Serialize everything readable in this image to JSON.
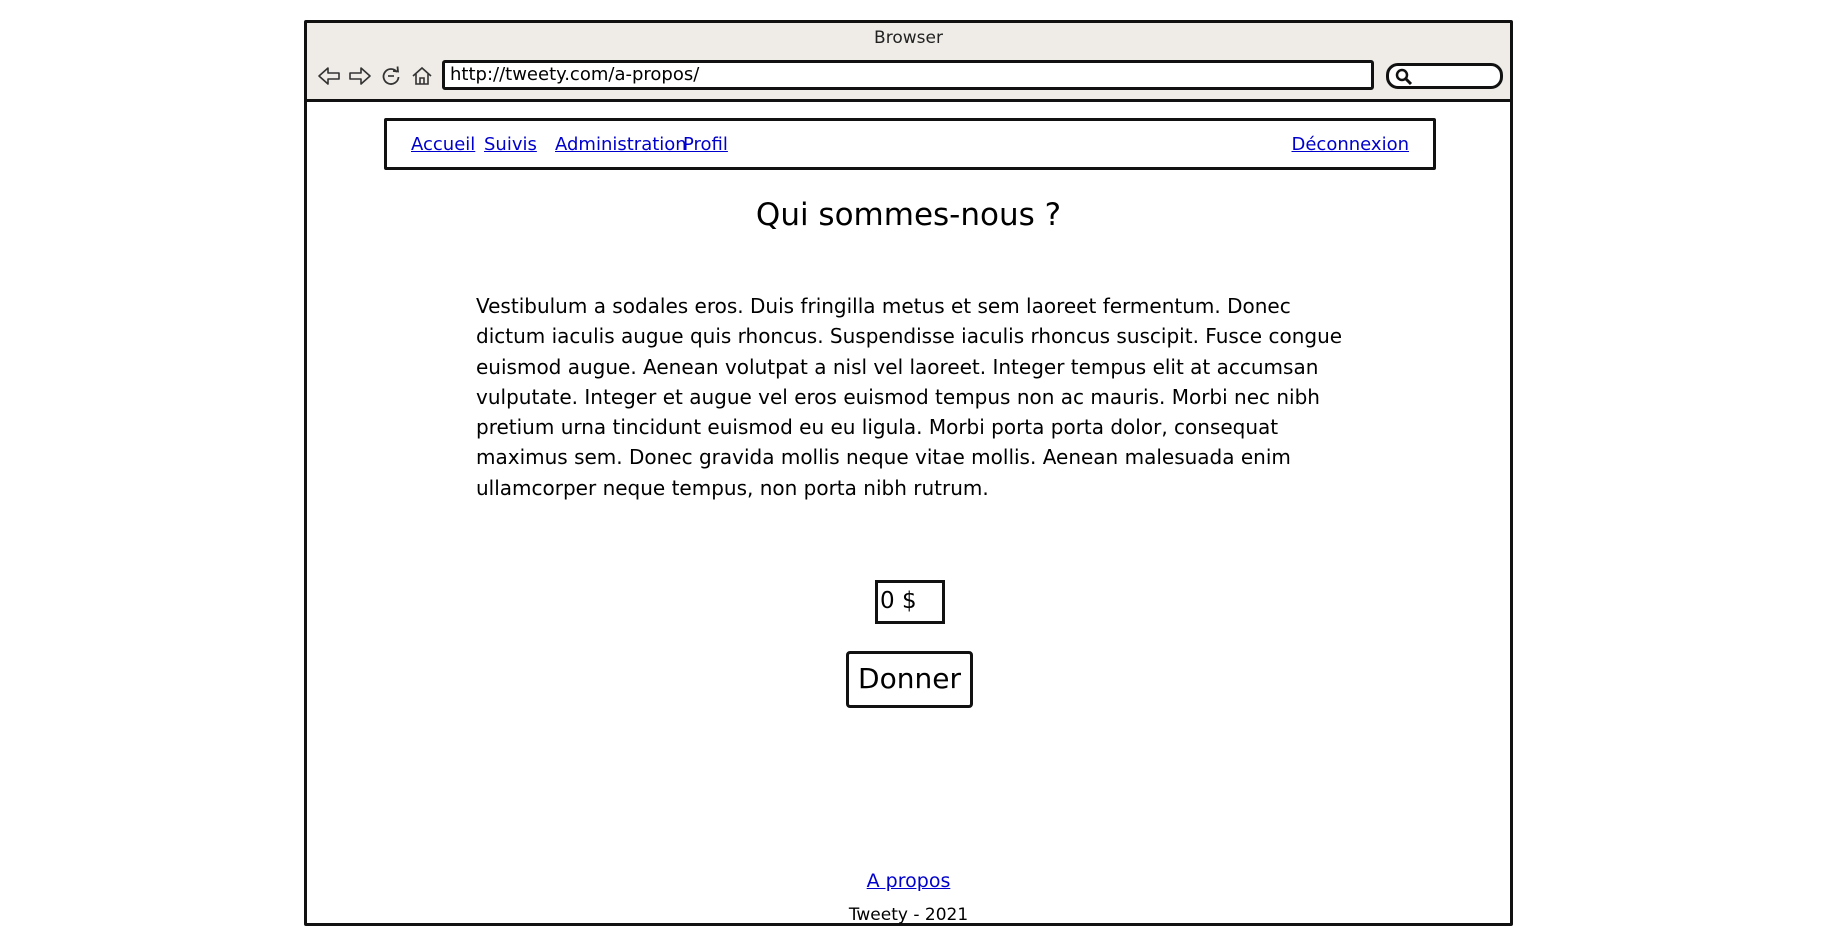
{
  "window": {
    "title": "Browser"
  },
  "toolbar": {
    "icons": [
      "back-arrow-icon",
      "forward-arrow-icon",
      "reload-icon",
      "home-icon"
    ],
    "url": "http://tweety.com/a-propos/",
    "search_icon": "search-icon"
  },
  "nav": {
    "items": [
      {
        "label": "Accueil"
      },
      {
        "label": "Suivis"
      },
      {
        "label": "Administration"
      },
      {
        "label": "Profil"
      }
    ],
    "logout": "Déconnexion"
  },
  "page": {
    "title": "Qui sommes-nous ?",
    "body": "Vestibulum a sodales eros. Duis fringilla metus et sem laoreet fermentum. Donec dictum iaculis augue quis rhoncus. Suspendisse iaculis rhoncus suscipit. Fusce congue euismod augue. Aenean volutpat a nisl vel laoreet. Integer tempus elit at accumsan vulputate. Integer et augue vel eros euismod tempus non ac mauris. Morbi nec nibh pretium urna tincidunt euismod eu eu ligula. Morbi porta porta dolor, consequat maximus sem. Donec gravida mollis neque vitae mollis. Aenean malesuada enim ullamcorper neque tempus, non porta nibh rutrum."
  },
  "donation": {
    "amount": "0 $",
    "button_label": "Donner"
  },
  "footer": {
    "link": "A propos",
    "copyright": "Tweety - 2021"
  },
  "colors": {
    "chrome_bg": "#efece7",
    "link": "#0000cc",
    "border": "#111111"
  }
}
